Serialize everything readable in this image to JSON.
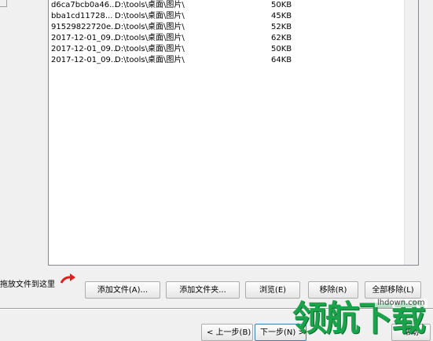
{
  "file_list": {
    "rows": [
      {
        "name": "d6ca7bcb0a46...",
        "path": "D:\\tools\\桌面\\图片\\",
        "size": "50KB"
      },
      {
        "name": "bba1cd11728...",
        "path": "D:\\tools\\桌面\\图片\\",
        "size": "45KB"
      },
      {
        "name": "91529822720e...",
        "path": "D:\\tools\\桌面\\图片\\",
        "size": "52KB"
      },
      {
        "name": "2017-12-01_09...",
        "path": "D:\\tools\\桌面\\图片\\",
        "size": "62KB"
      },
      {
        "name": "2017-12-01_09...",
        "path": "D:\\tools\\桌面\\图片\\",
        "size": "50KB"
      },
      {
        "name": "2017-12-01_09...",
        "path": "D:\\tools\\桌面\\图片\\",
        "size": "64KB"
      }
    ]
  },
  "drop_hint": "拖放文件到这里",
  "drop_arrow_icon": "red-curved-arrow-icon",
  "buttons": {
    "add_file": "添加文件(A)...",
    "add_folder": "添加文件夹...",
    "browse": "浏览(E)",
    "remove": "移除(R)",
    "remove_all": "全部移除(L)",
    "prev": "< 上一步(B)",
    "next": "下一步(N) >",
    "help": "帮助"
  },
  "watermark": {
    "text": "领航下载",
    "url": "lhdown.com"
  },
  "colors": {
    "accent_red": "#e02020",
    "watermark_green": "#1aa34a"
  }
}
